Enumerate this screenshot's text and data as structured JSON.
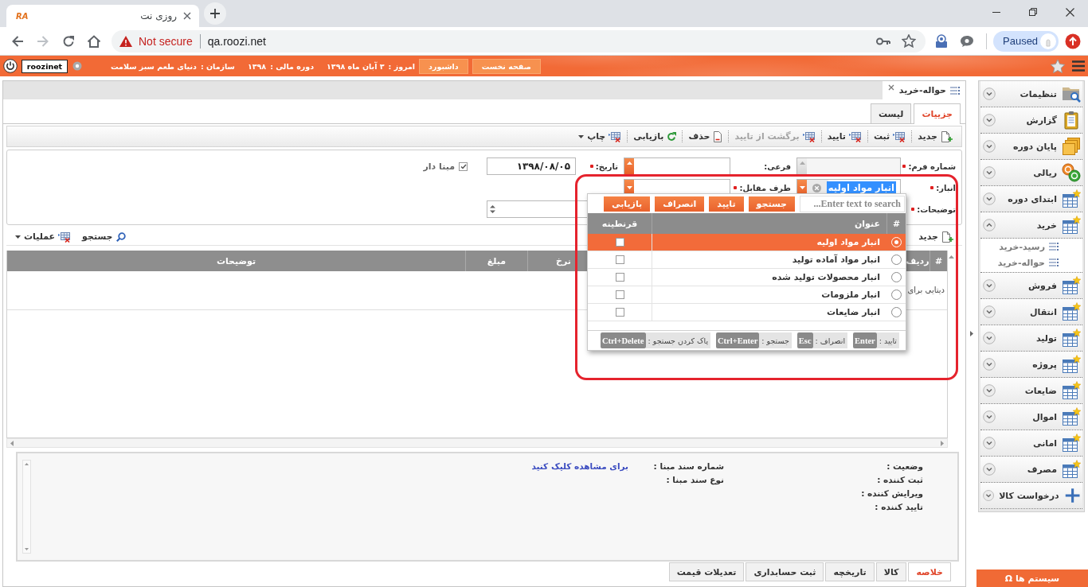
{
  "browser": {
    "tab": {
      "logo": "RA",
      "title": "روزی نت"
    },
    "address_bar": {
      "security": "Not secure",
      "url": "qa.roozi.net"
    },
    "profile": {
      "label": "Paused"
    }
  },
  "app_header": {
    "buttons": [
      "صفحه نخست",
      "داشبورد"
    ],
    "info": [
      {
        "label": "امروز :",
        "value": "۳ آبان ماه ۱۳۹۸"
      },
      {
        "label": "دوره مالی :",
        "value": "۱۳۹۸"
      },
      {
        "label": "سازمان :",
        "value": "دنیای طعم سبز سلامت"
      }
    ],
    "user": "roozinet"
  },
  "document_tabs": [
    {
      "label": "حواله-خرید",
      "selected": true
    }
  ],
  "view_tabs": [
    {
      "label": "جزییات",
      "selected": true
    },
    {
      "label": "لیست",
      "selected": false
    }
  ],
  "toolbar": [
    {
      "kind": "new",
      "label": "جدید",
      "disabled": false,
      "dropdown": false
    },
    {
      "kind": "grid",
      "label": "ثبت",
      "disabled": false,
      "dropdown": false
    },
    {
      "kind": "grid",
      "label": "تایید",
      "disabled": false,
      "dropdown": false
    },
    {
      "kind": "grid",
      "label": "برگشت از تایید",
      "disabled": true,
      "dropdown": false
    },
    {
      "kind": "page",
      "label": "حذف",
      "disabled": false,
      "dropdown": false
    },
    {
      "kind": "refresh",
      "label": "بازیابی",
      "disabled": false,
      "dropdown": false
    },
    {
      "kind": "grid",
      "label": "چاپ",
      "disabled": false,
      "dropdown": true
    }
  ],
  "form": {
    "rows": [
      {
        "fields": [
          {
            "kind": "number",
            "label": "شماره فرم:",
            "required": true,
            "disabled": true
          },
          {
            "kind": "number",
            "label": "فرعی:",
            "required": false,
            "disabled": false
          },
          {
            "kind": "date",
            "label": "تاریخ:",
            "required": true,
            "value": "۱۳۹۸/۰۸/۰۵"
          },
          {
            "kind": "checkbox",
            "label": "مبنا دار",
            "checked": true
          }
        ]
      },
      {
        "fields": [
          {
            "kind": "combo",
            "label": "انبار:",
            "required": true,
            "value": "انبار مواد اولیه",
            "clearable": true
          },
          {
            "kind": "combo",
            "label": "طرف مقابل:",
            "required": true,
            "clearable": false
          }
        ]
      },
      {
        "fields": [
          {
            "kind": "textarea",
            "label": "توضیحات:",
            "required": true
          }
        ]
      }
    ]
  },
  "grid": {
    "toolbar": [
      {
        "kind": "new",
        "label": "جدید",
        "dropdown": false
      },
      {
        "kind": "search",
        "label": "جستجو",
        "dropdown": false
      },
      {
        "kind": "grid",
        "label": "عملیات",
        "dropdown": true
      }
    ],
    "columns": [
      "#",
      "ردیف",
      "نرخ",
      "مبلغ",
      "توضیحات"
    ],
    "empty_message": "دیتایی برای"
  },
  "summary": {
    "status_fields": [
      "وضعیت :",
      "ثبت کننده :",
      "ویرایش کننده :",
      "تایید کننده :"
    ],
    "source_fields": [
      {
        "label": "شماره سند مبنا :",
        "link": "برای مشاهده کلیک کنید"
      },
      {
        "label": "نوع سند مبنا :"
      }
    ]
  },
  "bottom_tabs": [
    {
      "label": "خلاصه",
      "selected": true
    },
    {
      "label": "کالا",
      "selected": false
    },
    {
      "label": "تاریخچه",
      "selected": false
    },
    {
      "label": "ثبت حسابداری",
      "selected": false
    },
    {
      "label": "تعدیلات قیمت",
      "selected": false
    }
  ],
  "sidebar": {
    "items": [
      {
        "kind": "settings",
        "label": "تنظیمات",
        "expanded": false
      },
      {
        "kind": "report",
        "label": "گزارش",
        "expanded": false
      },
      {
        "kind": "folders",
        "label": "پایان دوره",
        "expanded": false
      },
      {
        "kind": "coins",
        "label": "ریالی",
        "expanded": false
      },
      {
        "kind": "table",
        "label": "ابتدای دوره",
        "expanded": false
      },
      {
        "kind": "table",
        "label": "خرید",
        "expanded": true,
        "children": [
          {
            "label": "رسید-خرید"
          },
          {
            "label": "حواله-خرید"
          }
        ]
      },
      {
        "kind": "table",
        "label": "فروش",
        "expanded": false
      },
      {
        "kind": "table",
        "label": "انتقال",
        "expanded": false
      },
      {
        "kind": "table",
        "label": "تولید",
        "expanded": false
      },
      {
        "kind": "table",
        "label": "پروژه",
        "expanded": false
      },
      {
        "kind": "table",
        "label": "ضایعات",
        "expanded": false
      },
      {
        "kind": "table",
        "label": "اموال",
        "expanded": false
      },
      {
        "kind": "table",
        "label": "امانی",
        "expanded": false
      },
      {
        "kind": "table",
        "label": "مصرف",
        "expanded": false
      },
      {
        "kind": "add",
        "label": "درخواست کالا",
        "expanded": false
      }
    ],
    "systems_button": {
      "label": "سیستم ها",
      "icon": "Ω"
    }
  },
  "lookup_popup": {
    "search": {
      "placeholder": "Enter text to search..."
    },
    "buttons": [
      "جستجو",
      "تایید",
      "انصراف",
      "بازیابی"
    ],
    "columns": [
      "#",
      "عنوان",
      "قرنطینه"
    ],
    "rows": [
      {
        "title": "انبار مواد اولیه",
        "selected": true,
        "quarantine": false
      },
      {
        "title": "انبار مواد آماده تولید",
        "selected": false,
        "quarantine": false
      },
      {
        "title": "انبار محصولات تولید شده",
        "selected": false,
        "quarantine": false
      },
      {
        "title": "انبار ملزومات",
        "selected": false,
        "quarantine": false
      },
      {
        "title": "انبار ضایعات",
        "selected": false,
        "quarantine": false
      }
    ],
    "shortcuts": [
      {
        "label": "تایید :",
        "key": "Enter"
      },
      {
        "label": "انصراف :",
        "key": "Esc"
      },
      {
        "label": "جستجو :",
        "key": "Ctrl+Enter"
      },
      {
        "label": "پاک کردن جستجو :",
        "key": "Ctrl+Delete"
      }
    ]
  },
  "annotation": {
    "kind": "outline"
  }
}
